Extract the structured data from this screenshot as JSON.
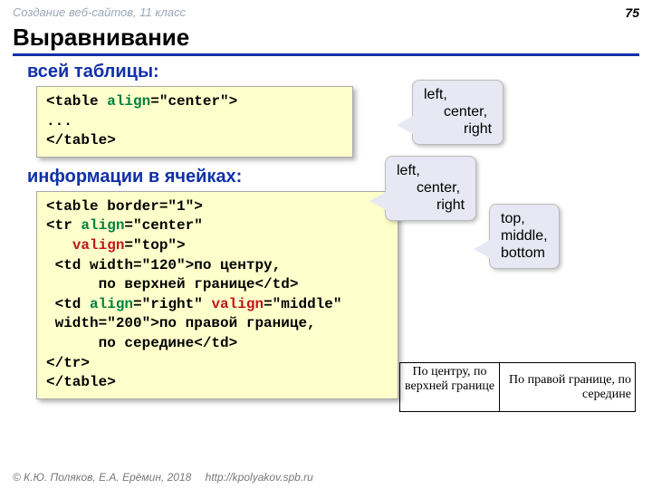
{
  "header": {
    "course": "Создание веб-сайтов, 11 класс",
    "page": "75"
  },
  "title": "Выравнивание",
  "sections": {
    "table_label": "всей таблицы:",
    "cells_label": "информации в ячейках:"
  },
  "code1": {
    "l1a": "<table ",
    "l1b": "align",
    "l1c": "=\"center\">",
    "l2": "...",
    "l3": "</table>"
  },
  "code2": {
    "l1": "<table border=\"1\">",
    "l2a": "<tr ",
    "l2b": "align",
    "l2c": "=\"center\"",
    "l3a": "   ",
    "l3b": "valign",
    "l3c": "=\"top\">",
    "l4": " <td width=\"120\">по центру,",
    "l5": "      по верхней границе</td>",
    "l6a": " <td ",
    "l6b": "align",
    "l6c": "=\"right\" ",
    "l6d": "valign",
    "l6e": "=\"middle\"",
    "l7": " width=\"200\">по правой границе,",
    "l8": "      по середине</td>",
    "l9": "</tr>",
    "l10": "</table>"
  },
  "callouts": {
    "align1": {
      "l1": "left,",
      "l2": "center,",
      "l3": "right"
    },
    "align2": {
      "l1": "left,",
      "l2": "center,",
      "l3": "right"
    },
    "valign": {
      "l1": "top,",
      "l2": "middle,",
      "l3": "bottom"
    }
  },
  "demo": {
    "c1": "По центру, по верхней границе",
    "c2": "По правой границе, по середине"
  },
  "footer": {
    "copyright": "© К.Ю. Поляков, Е.А. Ерёмин, 2018",
    "url": "http://kpolyakov.spb.ru"
  }
}
